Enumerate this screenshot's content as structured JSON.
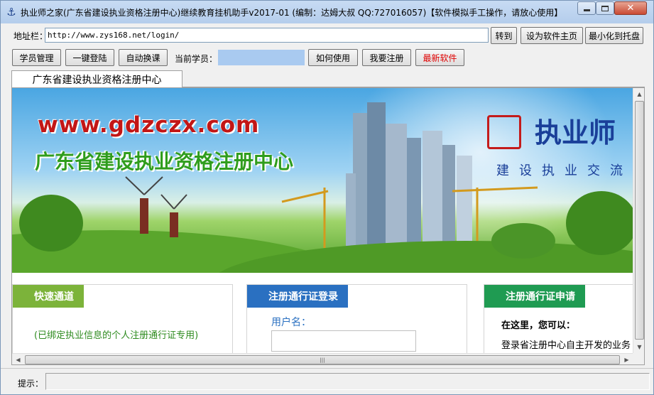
{
  "window": {
    "title": "执业师之家(广东省建设执业资格注册中心)继续教育挂机助手v2017-01 (编制：达姆大叔 QQ:727016057)【软件模拟手工操作，请放心使用】",
    "icon": "anchor-icon"
  },
  "toolbar": {
    "address_label": "地址栏：",
    "address_value": "http://www.zys168.net/login/",
    "go_label": "转到",
    "set_home_label": "设为软件主页",
    "minimize_tray_label": "最小化到托盘",
    "student_manage_label": "学员管理",
    "one_click_login_label": "一键登陆",
    "auto_switch_label": "自动换课",
    "current_student_label": "当前学员：",
    "current_student_value": "",
    "how_to_use_label": "如何使用",
    "register_label": "我要注册",
    "latest_software_label": "最新软件",
    "latest_software_color": "#e00000"
  },
  "tabs": [
    {
      "label": "广东省建设执业资格注册中心"
    }
  ],
  "page": {
    "banner": {
      "url": "www.gdzczx.com",
      "org": "广东省建设执业资格注册中心",
      "logo_title": "执业师",
      "logo_sub": "建设执业交流"
    },
    "panels": [
      {
        "header": "快速通道",
        "text": "(已绑定执业信息的个人注册通行证专用)"
      },
      {
        "header": "注册通行证登录",
        "username_label": "用户名："
      },
      {
        "header": "注册通行证申请",
        "line1": "在这里，您可以：",
        "line2": "登录省注册中心自主开发的业务"
      }
    ]
  },
  "status": {
    "label": "提示：",
    "value": ""
  }
}
